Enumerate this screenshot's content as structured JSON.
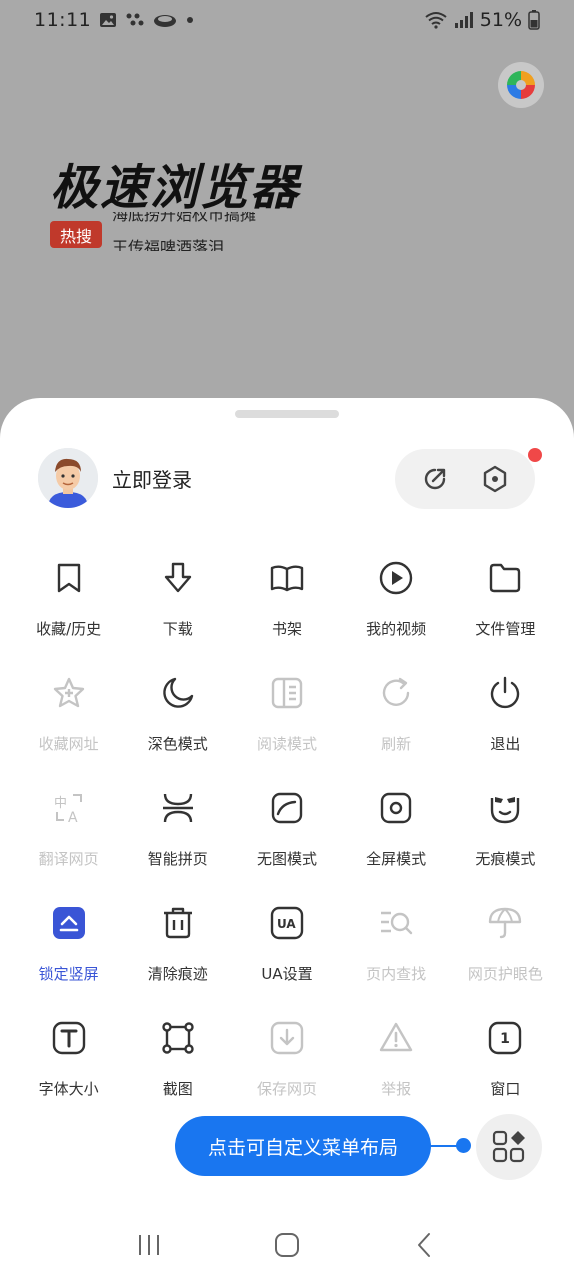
{
  "status": {
    "time": "11:11",
    "battery": "51%",
    "icons": [
      "image-icon",
      "dots-icon",
      "cloud-icon",
      "dot-icon",
      "wifi-icon",
      "signal-icon",
      "battery-icon"
    ]
  },
  "background": {
    "title": "极速浏览器",
    "hot_badge": "热搜",
    "hot_line_1": "海底捞开始权市搞摊",
    "hot_line_2": "王传福啤酒落泪"
  },
  "sheet": {
    "login_label": "立即登录",
    "quick_actions": [
      "share-icon",
      "settings-hex-icon"
    ],
    "menu": [
      {
        "label": "收藏/历史",
        "icon": "bookmark-icon",
        "state": "normal"
      },
      {
        "label": "下载",
        "icon": "download-icon",
        "state": "normal"
      },
      {
        "label": "书架",
        "icon": "book-icon",
        "state": "normal"
      },
      {
        "label": "我的视频",
        "icon": "video-icon",
        "state": "normal"
      },
      {
        "label": "文件管理",
        "icon": "folder-icon",
        "state": "normal"
      },
      {
        "label": "收藏网址",
        "icon": "star-plus-icon",
        "state": "disabled"
      },
      {
        "label": "深色模式",
        "icon": "moon-icon",
        "state": "normal"
      },
      {
        "label": "阅读模式",
        "icon": "reading-icon",
        "state": "disabled"
      },
      {
        "label": "刷新",
        "icon": "refresh-icon",
        "state": "disabled"
      },
      {
        "label": "退出",
        "icon": "power-icon",
        "state": "normal"
      },
      {
        "label": "翻译网页",
        "icon": "translate-icon",
        "state": "disabled"
      },
      {
        "label": "智能拼页",
        "icon": "page-merge-icon",
        "state": "normal"
      },
      {
        "label": "无图模式",
        "icon": "no-image-icon",
        "state": "normal"
      },
      {
        "label": "全屏模式",
        "icon": "fullscreen-icon",
        "state": "normal"
      },
      {
        "label": "无痕模式",
        "icon": "mask-icon",
        "state": "normal"
      },
      {
        "label": "锁定竖屏",
        "icon": "lock-portrait-icon",
        "state": "active"
      },
      {
        "label": "清除痕迹",
        "icon": "trash-icon",
        "state": "normal"
      },
      {
        "label": "UA设置",
        "icon": "ua-icon",
        "state": "normal"
      },
      {
        "label": "页内查找",
        "icon": "find-in-page-icon",
        "state": "disabled"
      },
      {
        "label": "网页护眼色",
        "icon": "umbrella-icon",
        "state": "disabled"
      },
      {
        "label": "字体大小",
        "icon": "font-size-icon",
        "state": "normal"
      },
      {
        "label": "截图",
        "icon": "screenshot-icon",
        "state": "normal"
      },
      {
        "label": "保存网页",
        "icon": "save-page-icon",
        "state": "disabled"
      },
      {
        "label": "举报",
        "icon": "warning-icon",
        "state": "disabled"
      },
      {
        "label": "窗口",
        "icon": "window-count-icon",
        "state": "normal",
        "badge": "1"
      }
    ],
    "customize_label": "点击可自定义菜单布局"
  },
  "colors": {
    "accent": "#1976f0",
    "active": "#3a55d6",
    "disabled": "#c4c4c4",
    "notification": "#f04848"
  }
}
